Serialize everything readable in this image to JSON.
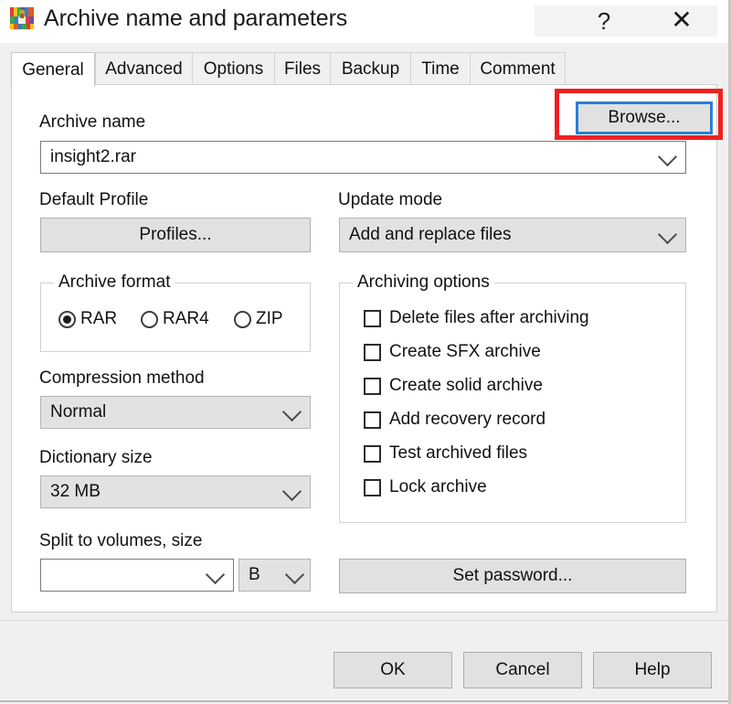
{
  "window": {
    "title": "Archive name and parameters",
    "icon": "winrar-books-icon",
    "help_glyph": "?",
    "close_glyph": "✕"
  },
  "tabs": [
    {
      "label": "General",
      "active": true
    },
    {
      "label": "Advanced",
      "active": false
    },
    {
      "label": "Options",
      "active": false
    },
    {
      "label": "Files",
      "active": false
    },
    {
      "label": "Backup",
      "active": false
    },
    {
      "label": "Time",
      "active": false
    },
    {
      "label": "Comment",
      "active": false
    }
  ],
  "general": {
    "archive_name_label": "Archive name",
    "archive_name_value": "insight2.rar",
    "browse_button": "Browse...",
    "default_profile_label": "Default Profile",
    "profiles_button": "Profiles...",
    "archive_format_label": "Archive format",
    "formats": [
      {
        "label": "RAR",
        "selected": true
      },
      {
        "label": "RAR4",
        "selected": false
      },
      {
        "label": "ZIP",
        "selected": false
      }
    ],
    "compression_method_label": "Compression method",
    "compression_method_value": "Normal",
    "dictionary_size_label": "Dictionary size",
    "dictionary_size_value": "32 MB",
    "split_label": "Split to volumes, size",
    "split_value": "",
    "split_unit_value": "B",
    "update_mode_label": "Update mode",
    "update_mode_value": "Add and replace files",
    "archiving_options_label": "Archiving options",
    "archiving_options": [
      {
        "label": "Delete files after archiving",
        "checked": false
      },
      {
        "label": "Create SFX archive",
        "checked": false
      },
      {
        "label": "Create solid archive",
        "checked": false
      },
      {
        "label": "Add recovery record",
        "checked": false
      },
      {
        "label": "Test archived files",
        "checked": false
      },
      {
        "label": "Lock archive",
        "checked": false
      }
    ],
    "set_password_button": "Set password..."
  },
  "footer": {
    "ok_button": "OK",
    "cancel_button": "Cancel",
    "help_button": "Help"
  },
  "annotation": {
    "highlight_target": "browse-button",
    "highlight_color": "#f01f1f",
    "focus_color": "#2a7fd4"
  }
}
